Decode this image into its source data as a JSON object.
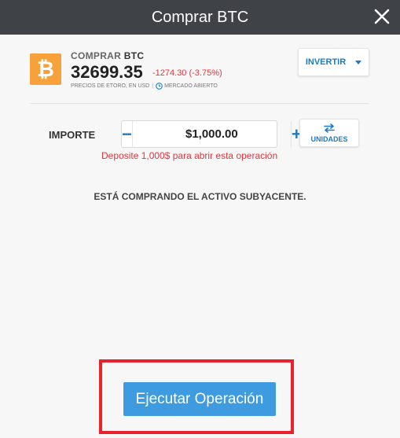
{
  "header": {
    "title": "Comprar BTC"
  },
  "asset": {
    "icon": "bitcoin-icon",
    "icon_color": "#f7a13a",
    "icon_glyph": "₿",
    "action": "COMPRAR",
    "symbol": "BTC",
    "price": "32699.35",
    "change": "-1274.30 (-3.75%)",
    "price_source": "PRECIOS DE ETORO, EN USD",
    "separator": "|",
    "market_status": "MERCADO ABIERTO"
  },
  "invest_button": {
    "label": "INVERTIR"
  },
  "amount": {
    "label": "IMPORTE",
    "value": "$1,000.00",
    "minus": "−",
    "plus": "+"
  },
  "units_button": {
    "label": "UNIDADES",
    "icon": "swap-arrows-icon"
  },
  "deposit_note": "Deposite 1,000$ para abrir esta operación",
  "underlying_note": "ESTÁ COMPRANDO EL ACTIVO SUBYACENTE.",
  "execute_button": {
    "label": "Ejecutar Operación"
  },
  "colors": {
    "header_bg": "#3f4247",
    "accent_blue": "#1c7bc2",
    "execute_blue": "#3e9be0",
    "negative_red": "#e0363d",
    "highlight_red": "#e8232e"
  }
}
